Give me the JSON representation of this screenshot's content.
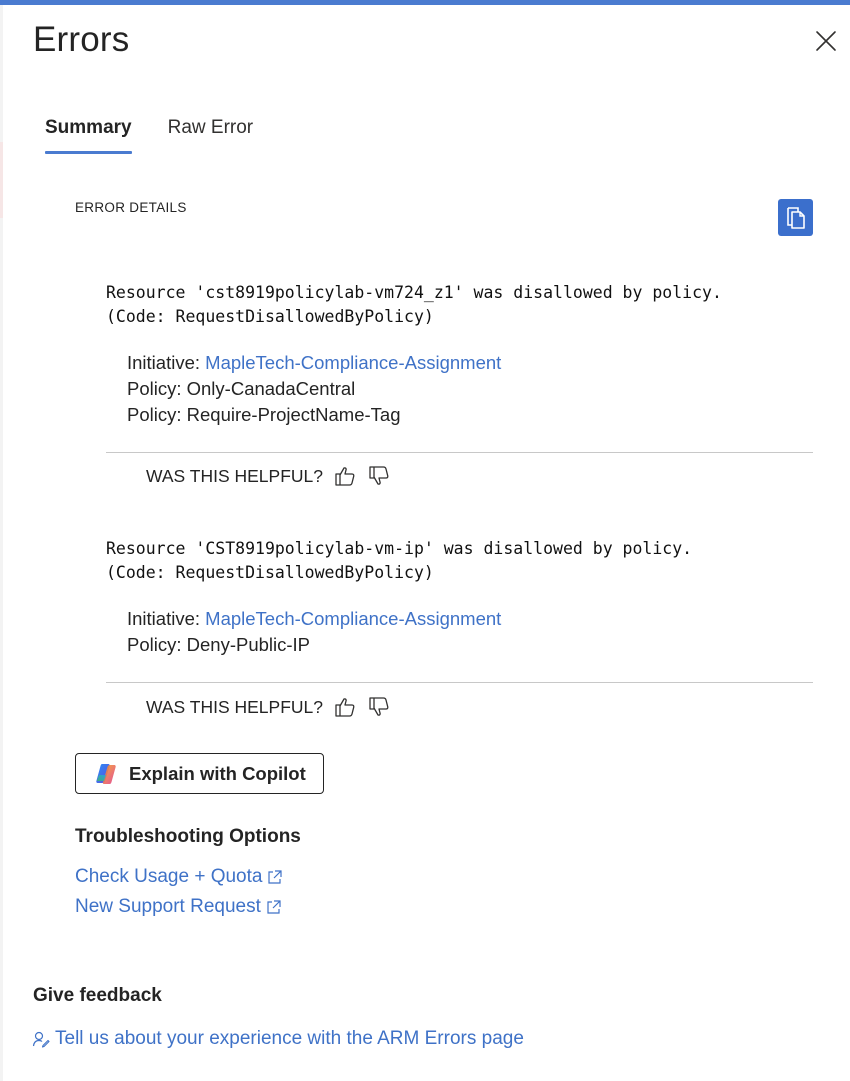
{
  "panel": {
    "title": "Errors"
  },
  "tabs": [
    {
      "label": "Summary",
      "active": true
    },
    {
      "label": "Raw Error",
      "active": false
    }
  ],
  "error_details": {
    "label": "ERROR DETAILS",
    "errors": [
      {
        "message_line1": "Resource 'cst8919policylab-vm724_z1' was disallowed by policy.",
        "message_line2": "(Code: RequestDisallowedByPolicy)",
        "initiative_label": "Initiative: ",
        "initiative_link": "MapleTech-Compliance-Assignment",
        "policies": [
          "Policy: Only-CanadaCentral",
          "Policy: Require-ProjectName-Tag"
        ]
      },
      {
        "message_line1": "Resource 'CST8919policylab-vm-ip' was disallowed by policy.",
        "message_line2": "(Code: RequestDisallowedByPolicy)",
        "initiative_label": "Initiative: ",
        "initiative_link": "MapleTech-Compliance-Assignment",
        "policies": [
          "Policy: Deny-Public-IP"
        ]
      }
    ],
    "helpful_prompt": "WAS THIS HELPFUL?"
  },
  "copilot": {
    "label": "Explain with Copilot"
  },
  "troubleshooting": {
    "title": "Troubleshooting Options",
    "links": [
      "Check Usage + Quota",
      "New Support Request"
    ]
  },
  "feedback": {
    "title": "Give feedback",
    "link": "Tell us about your experience with the ARM Errors page"
  },
  "colors": {
    "accent": "#4a7bd0",
    "link": "#3f72c7",
    "copy_button": "#3b6fcc"
  },
  "icons": [
    "close-icon",
    "copy-icon",
    "thumbs-up-icon",
    "thumbs-down-icon",
    "copilot-icon",
    "external-link-icon",
    "feedback-icon"
  ]
}
